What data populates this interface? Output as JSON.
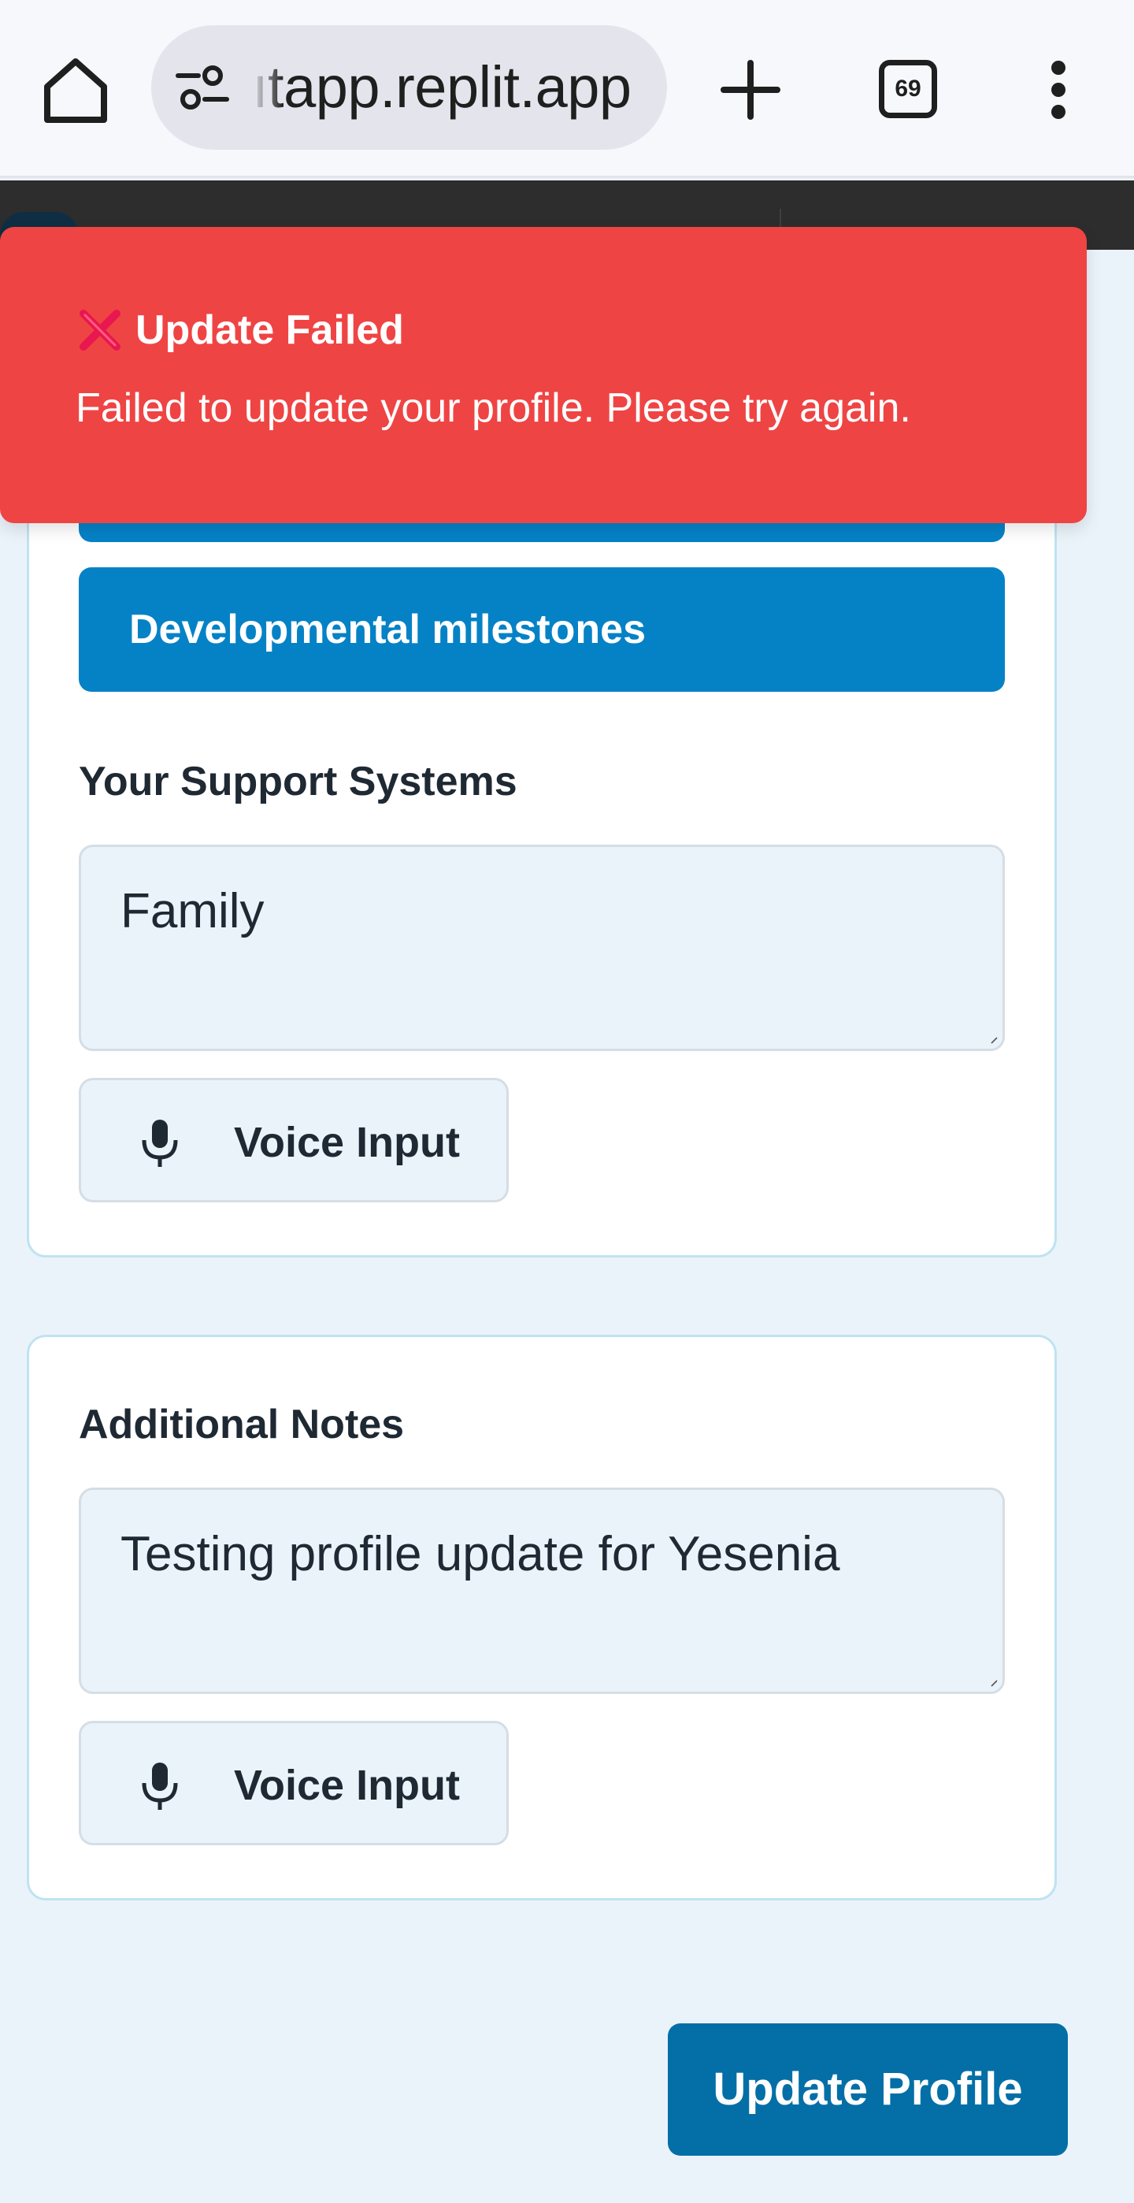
{
  "browser": {
    "url": "ıtapp.replit.app",
    "tab_count": "69"
  },
  "icons": {
    "home": "home-icon",
    "site_info": "tune-icon",
    "new_tab": "plus-icon",
    "menu": "more-vert-icon",
    "mic": "mic-icon",
    "error": "cross-mark-icon"
  },
  "toast": {
    "title": "Update Failed",
    "message": "Failed to update your profile. Please try again."
  },
  "support_card": {
    "topic_buttons": [
      "",
      "Developmental milestones"
    ],
    "label": "Your Support Systems",
    "value": "Family",
    "voice_label": "Voice Input"
  },
  "notes_card": {
    "label": "Additional Notes",
    "value": "Testing profile update for Yesenia",
    "voice_label": "Voice Input"
  },
  "footer": {
    "update_label": "Update Profile"
  },
  "colors": {
    "toast_bg": "#ef4444",
    "topic_bg": "#0582c6",
    "primary_btn": "#046fa6",
    "page_bg": "#ebf3fa",
    "card_border": "#bfe3f2"
  }
}
